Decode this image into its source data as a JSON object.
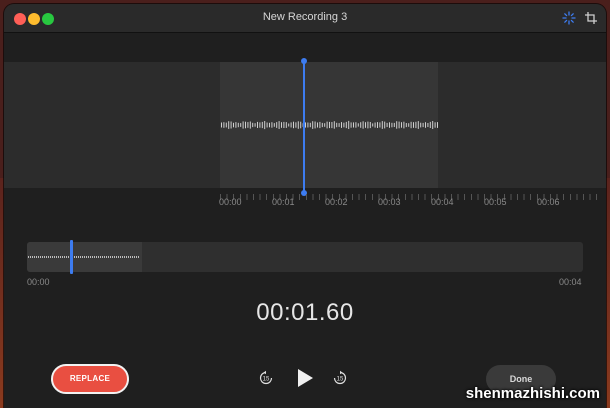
{
  "window": {
    "title": "New Recording 3"
  },
  "toolbar": {
    "enhance_icon": "sparkle-icon",
    "trim_icon": "trim-icon"
  },
  "ruler": {
    "labels": [
      "00:00",
      "00:01",
      "00:02",
      "00:03",
      "00:04",
      "00:05",
      "00:06"
    ]
  },
  "overview": {
    "start_label": "00:00",
    "end_label": "00:04"
  },
  "timer": {
    "value": "00:01.60"
  },
  "controls": {
    "replace_label": "REPLACE",
    "done_label": "Done",
    "skip_back_label": "15",
    "skip_forward_label": "15"
  },
  "watermark": {
    "text": "shenmazhishi.com"
  },
  "colors": {
    "accent": "#3d7cf0",
    "replace": "#e94f41"
  }
}
